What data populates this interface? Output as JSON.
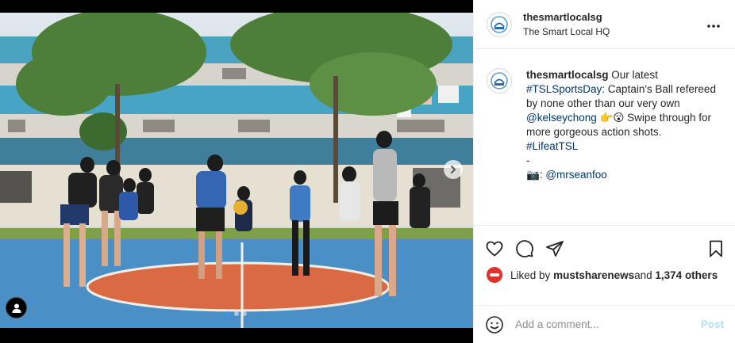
{
  "post": {
    "username": "thesmartlocalsg",
    "location": "The Smart Local HQ",
    "more_icon": "more-horizontal-icon",
    "caption": {
      "username": "thesmartlocalsg",
      "text_1": " Our latest ",
      "hashtag_1": "#TSLSportsDay",
      "text_2": ": Captain's Ball refereed by none other than our very own ",
      "mention_1": "@kelseychong",
      "emoji_1": "👉😮",
      "text_3": " Swipe through for more gorgeous action shots.",
      "hashtag_2": "#LifeatTSL",
      "dash": "-",
      "camera_emoji": "📷",
      "colon": ": ",
      "mention_2": "@mrseanfoo"
    },
    "likes": {
      "prefix": "Liked by ",
      "liker": "mustsharenews",
      "middle": " and ",
      "count": "1,374 others"
    },
    "comment": {
      "placeholder": "Add a comment...",
      "post_label": "Post"
    },
    "carousel": {
      "slides": 3,
      "current": 1
    },
    "colors": {
      "accent": "#3897f0",
      "link": "#00376b",
      "muted": "#8e8e8e"
    }
  }
}
